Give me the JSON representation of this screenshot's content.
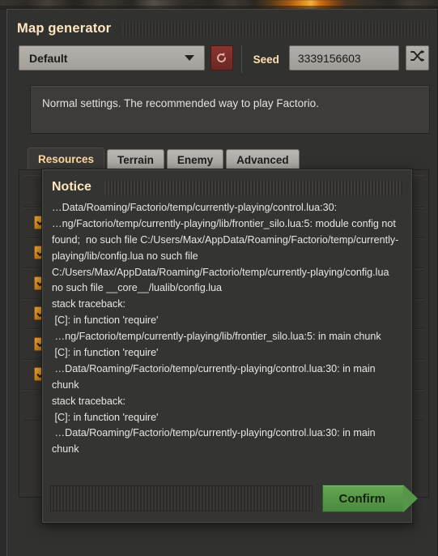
{
  "window": {
    "title": "Map generator"
  },
  "preset": {
    "selected": "Default",
    "options": [
      "Default"
    ],
    "reset_icon": "reset-arrow-icon",
    "caret_icon": "chevron-down-icon"
  },
  "seed": {
    "label": "Seed",
    "value": "3339156603",
    "placeholder": "",
    "shuffle_icon": "shuffle-icon"
  },
  "description": {
    "text": "Normal settings. The recommended way to play Factorio."
  },
  "tabs": [
    {
      "label": "Resources",
      "active": true
    },
    {
      "label": "Terrain",
      "active": false
    },
    {
      "label": "Enemy",
      "active": false
    },
    {
      "label": "Advanced",
      "active": false
    }
  ],
  "settings_rows": [
    {
      "checked": null,
      "slider": false
    },
    {
      "checked": true,
      "slider": true
    },
    {
      "checked": true,
      "slider": true
    },
    {
      "checked": true,
      "slider": true
    },
    {
      "checked": true,
      "slider": true
    },
    {
      "checked": true,
      "slider": true
    },
    {
      "checked": true,
      "slider": true
    },
    {
      "checked": null,
      "slider": false
    }
  ],
  "notice": {
    "title": "Notice",
    "body": "…Data/Roaming/Factorio/temp/currently-playing/control.lua:30:\n…ng/Factorio/temp/currently-playing/lib/frontier_silo.lua:5: module config not found;  no such file C:/Users/Max/AppData/Roaming/Factorio/temp/currently-playing/lib/config.lua no such file C:/Users/Max/AppData/Roaming/Factorio/temp/currently-playing/config.lua no such file __core__/lualib/config.lua\nstack traceback:\n [C]: in function 'require'\n …ng/Factorio/temp/currently-playing/lib/frontier_silo.lua:5: in main chunk\n [C]: in function 'require'\n …Data/Roaming/Factorio/temp/currently-playing/control.lua:30: in main chunk\nstack traceback:\n [C]: in function 'require'\n …Data/Roaming/Factorio/temp/currently-playing/control.lua:30: in main chunk",
    "confirm_label": "Confirm"
  },
  "colors": {
    "accent_orange": "#ffe6c0",
    "confirm_green": "#56964a",
    "checkbox_orange": "#e09a28",
    "reset_red": "#7c2e29",
    "panel_bg": "#333230",
    "modal_bg": "#343432"
  }
}
